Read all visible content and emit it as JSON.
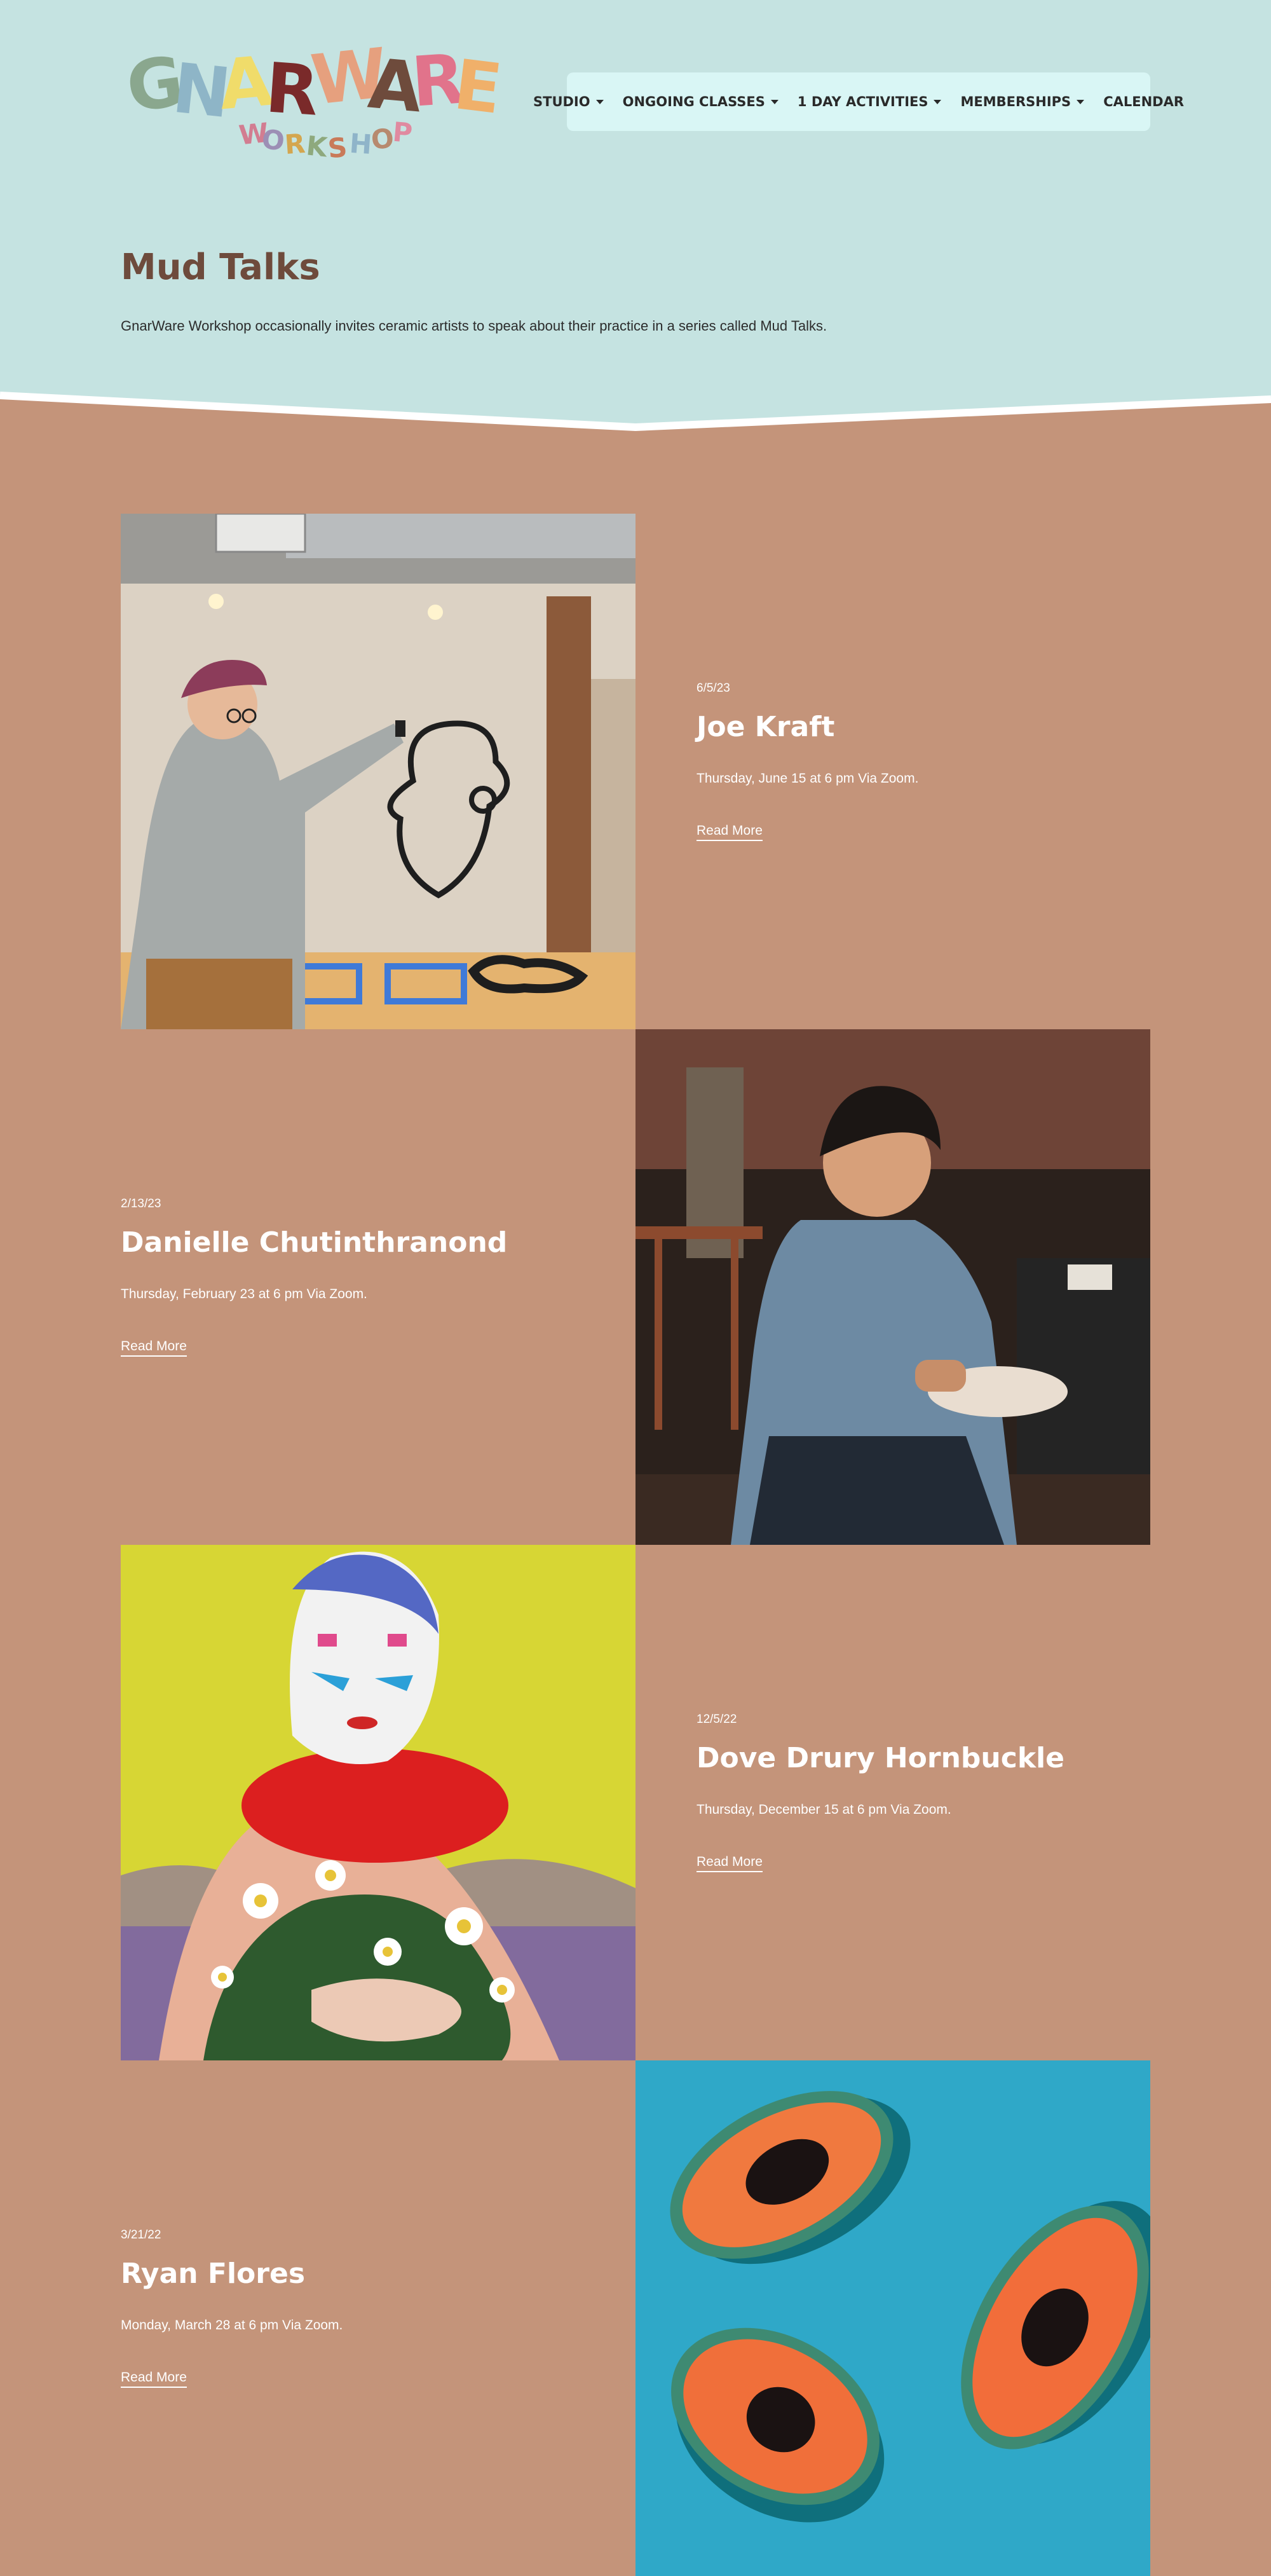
{
  "logo": {
    "letters": [
      "G",
      "N",
      "A",
      "R",
      "W",
      "A",
      "R",
      "E"
    ],
    "letter_colors": [
      "#8aa78e",
      "#8eb5c7",
      "#f0dc6a",
      "#7a2a2a",
      "#e6a07e",
      "#6e4b3c",
      "#e1738b",
      "#f0b06a"
    ],
    "sub": [
      "W",
      "O",
      "R",
      "K",
      "S",
      "H",
      "O",
      "P"
    ],
    "sub_colors": [
      "#d27d91",
      "#9c8fb5",
      "#d4a64f",
      "#8ea97d",
      "#c97a59",
      "#8fb4c9",
      "#b78a6f",
      "#e08aa0"
    ]
  },
  "nav": [
    {
      "label": "STUDIO",
      "dropdown": true
    },
    {
      "label": "ONGOING CLASSES",
      "dropdown": true
    },
    {
      "label": "1 DAY ACTIVITIES",
      "dropdown": true
    },
    {
      "label": "MEMBERSHIPS",
      "dropdown": true
    },
    {
      "label": "CALENDAR",
      "dropdown": false
    }
  ],
  "page": {
    "title": "Mud Talks",
    "intro": "GnarWare Workshop occasionally invites ceramic artists to speak about their practice in a series called Mud Talks."
  },
  "talks": [
    {
      "date": "6/5/23",
      "name": "Joe Kraft",
      "desc": "Thursday, June 15 at 6 pm Via Zoom.",
      "link": "Read More"
    },
    {
      "date": "2/13/23",
      "name": "Danielle Chutinthranond",
      "desc": "Thursday, February 23 at 6 pm Via Zoom.",
      "link": "Read More"
    },
    {
      "date": "12/5/22",
      "name": "Dove Drury Hornbuckle",
      "desc": "Thursday, December 15 at 6 pm Via Zoom.",
      "link": "Read More"
    },
    {
      "date": "3/21/22",
      "name": "Ryan Flores",
      "desc": "Monday, March 28 at 6 pm Via Zoom.",
      "link": "Read More"
    }
  ],
  "colors": {
    "header_bg": "#c5e3e1",
    "body_bg": "#c4947a",
    "nav_bg": "#d9f6f5",
    "title": "#6e4b3c"
  }
}
